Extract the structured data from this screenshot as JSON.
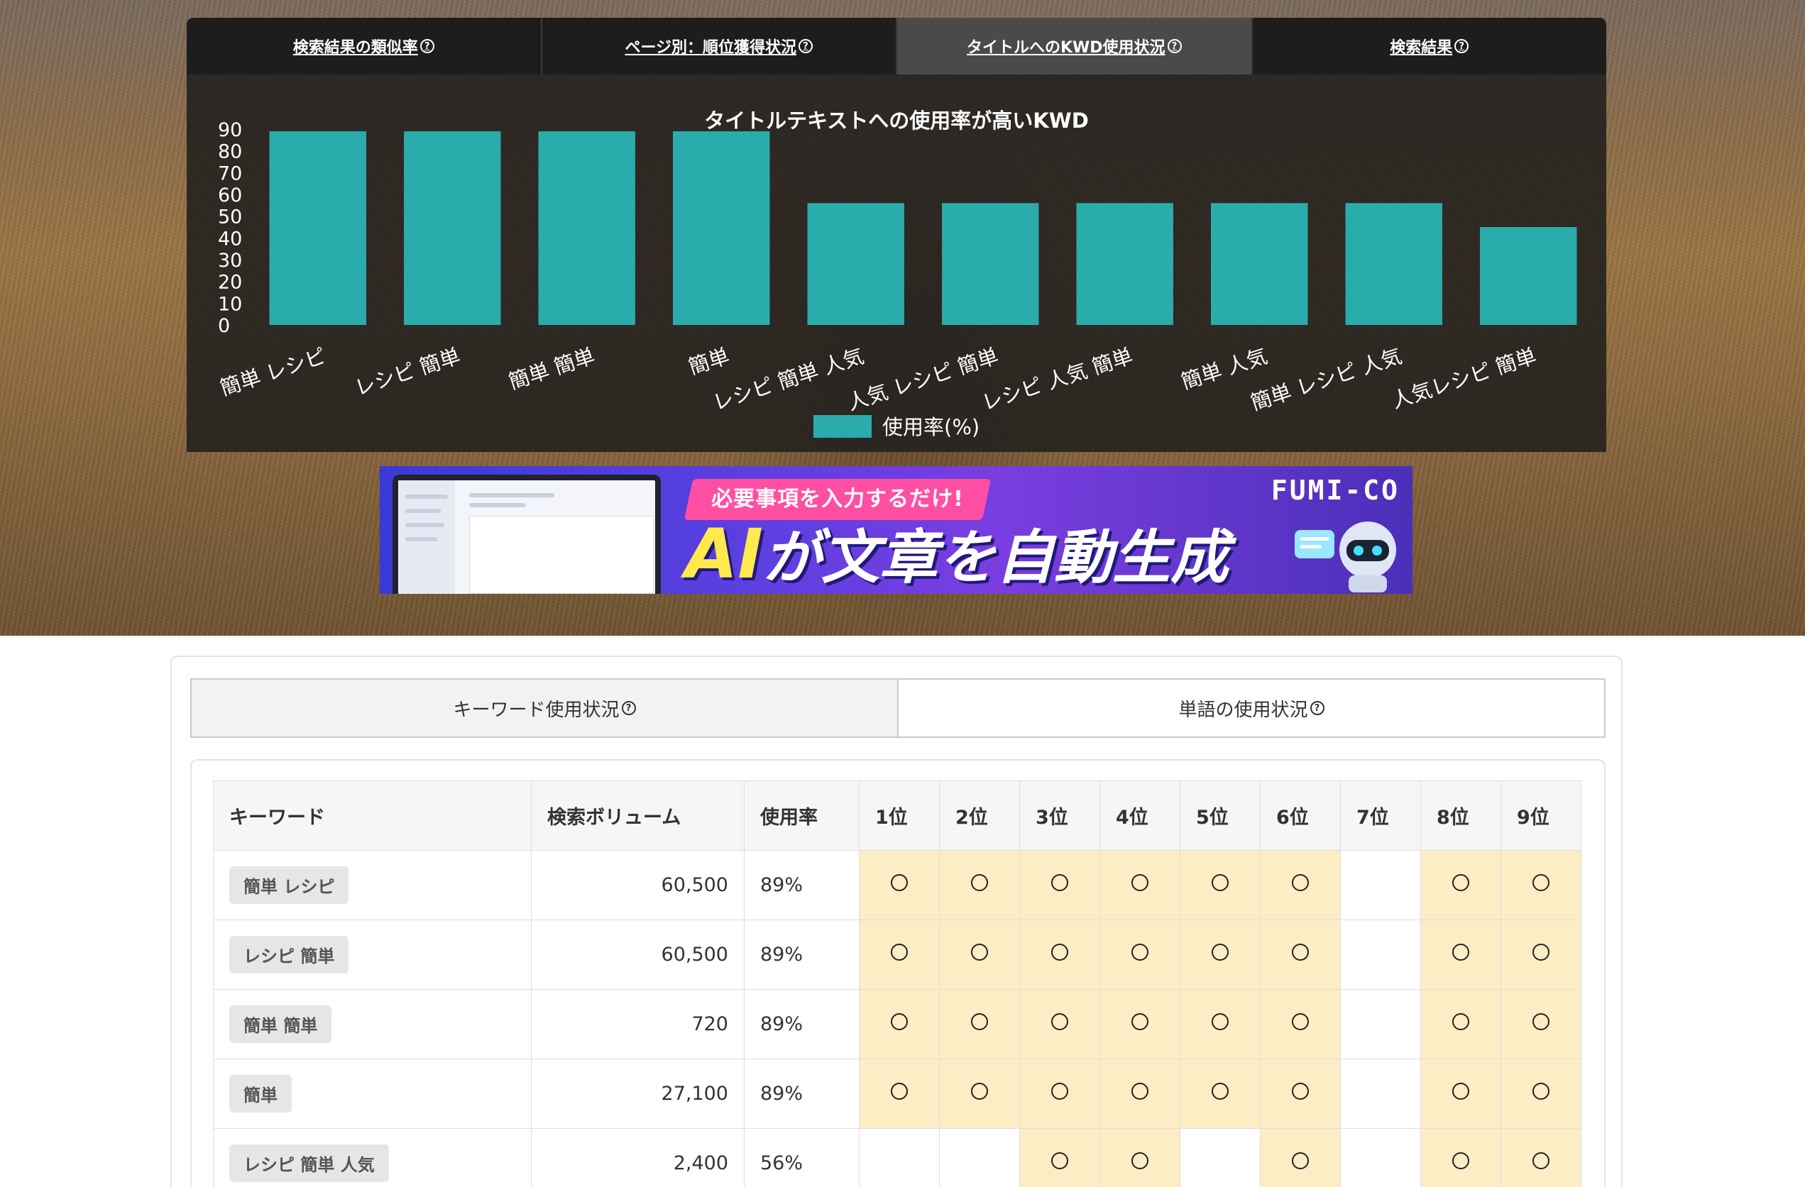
{
  "top_tabs": [
    {
      "label": "検索結果の類似率"
    },
    {
      "label": "ページ別：順位獲得状況"
    },
    {
      "label": "タイトルへのKWD使用状況"
    },
    {
      "label": "検索結果"
    }
  ],
  "help_glyph": "?",
  "chart_data": {
    "type": "bar",
    "title": "タイトルテキストへの使用率が高いKWD",
    "categories": [
      "簡単 レシピ",
      "レシピ 簡単",
      "簡単 簡単",
      "簡単",
      "レシピ 簡単 人気",
      "人気 レシピ 簡単",
      "レシピ 人気 簡単",
      "簡単 人気",
      "簡単 レシピ 人気",
      "人気レシピ 簡単"
    ],
    "series": [
      {
        "name": "使用率(%)",
        "values": [
          89,
          89,
          89,
          89,
          56,
          56,
          56,
          56,
          56,
          45
        ],
        "color": "#2aacad"
      }
    ],
    "yticks": [
      0,
      10,
      20,
      30,
      40,
      50,
      60,
      70,
      80,
      90
    ],
    "ylim": [
      0,
      90
    ],
    "legend_position": "bottom",
    "grid": false
  },
  "banner": {
    "tagline": "必要事項を入力するだけ!",
    "headline_ai": "AI",
    "headline_rest": "が文章を自動生成",
    "logo": "FUMI-CO"
  },
  "sub_tabs": [
    {
      "label": "キーワード使用状況"
    },
    {
      "label": "単語の使用状況"
    }
  ],
  "table": {
    "headers": [
      "キーワード",
      "検索ボリューム",
      "使用率",
      "1位",
      "2位",
      "3位",
      "4位",
      "5位",
      "6位",
      "7位",
      "8位",
      "9位"
    ],
    "rows": [
      {
        "keyword": "簡単 レシピ",
        "volume": "60,500",
        "rate": "89%",
        "ranks": [
          true,
          true,
          true,
          true,
          true,
          true,
          false,
          true,
          true
        ]
      },
      {
        "keyword": "レシピ 簡単",
        "volume": "60,500",
        "rate": "89%",
        "ranks": [
          true,
          true,
          true,
          true,
          true,
          true,
          false,
          true,
          true
        ]
      },
      {
        "keyword": "簡単 簡単",
        "volume": "720",
        "rate": "89%",
        "ranks": [
          true,
          true,
          true,
          true,
          true,
          true,
          false,
          true,
          true
        ]
      },
      {
        "keyword": "簡単",
        "volume": "27,100",
        "rate": "89%",
        "ranks": [
          true,
          true,
          true,
          true,
          true,
          true,
          false,
          true,
          true
        ]
      },
      {
        "keyword": "レシピ 簡単 人気",
        "volume": "2,400",
        "rate": "56%",
        "ranks": [
          false,
          false,
          true,
          true,
          false,
          true,
          false,
          true,
          true
        ]
      }
    ]
  },
  "colors": {
    "bar": "#2aacad",
    "rank_hit": "#fdedc4",
    "active_tab": "#4a4a4a"
  }
}
